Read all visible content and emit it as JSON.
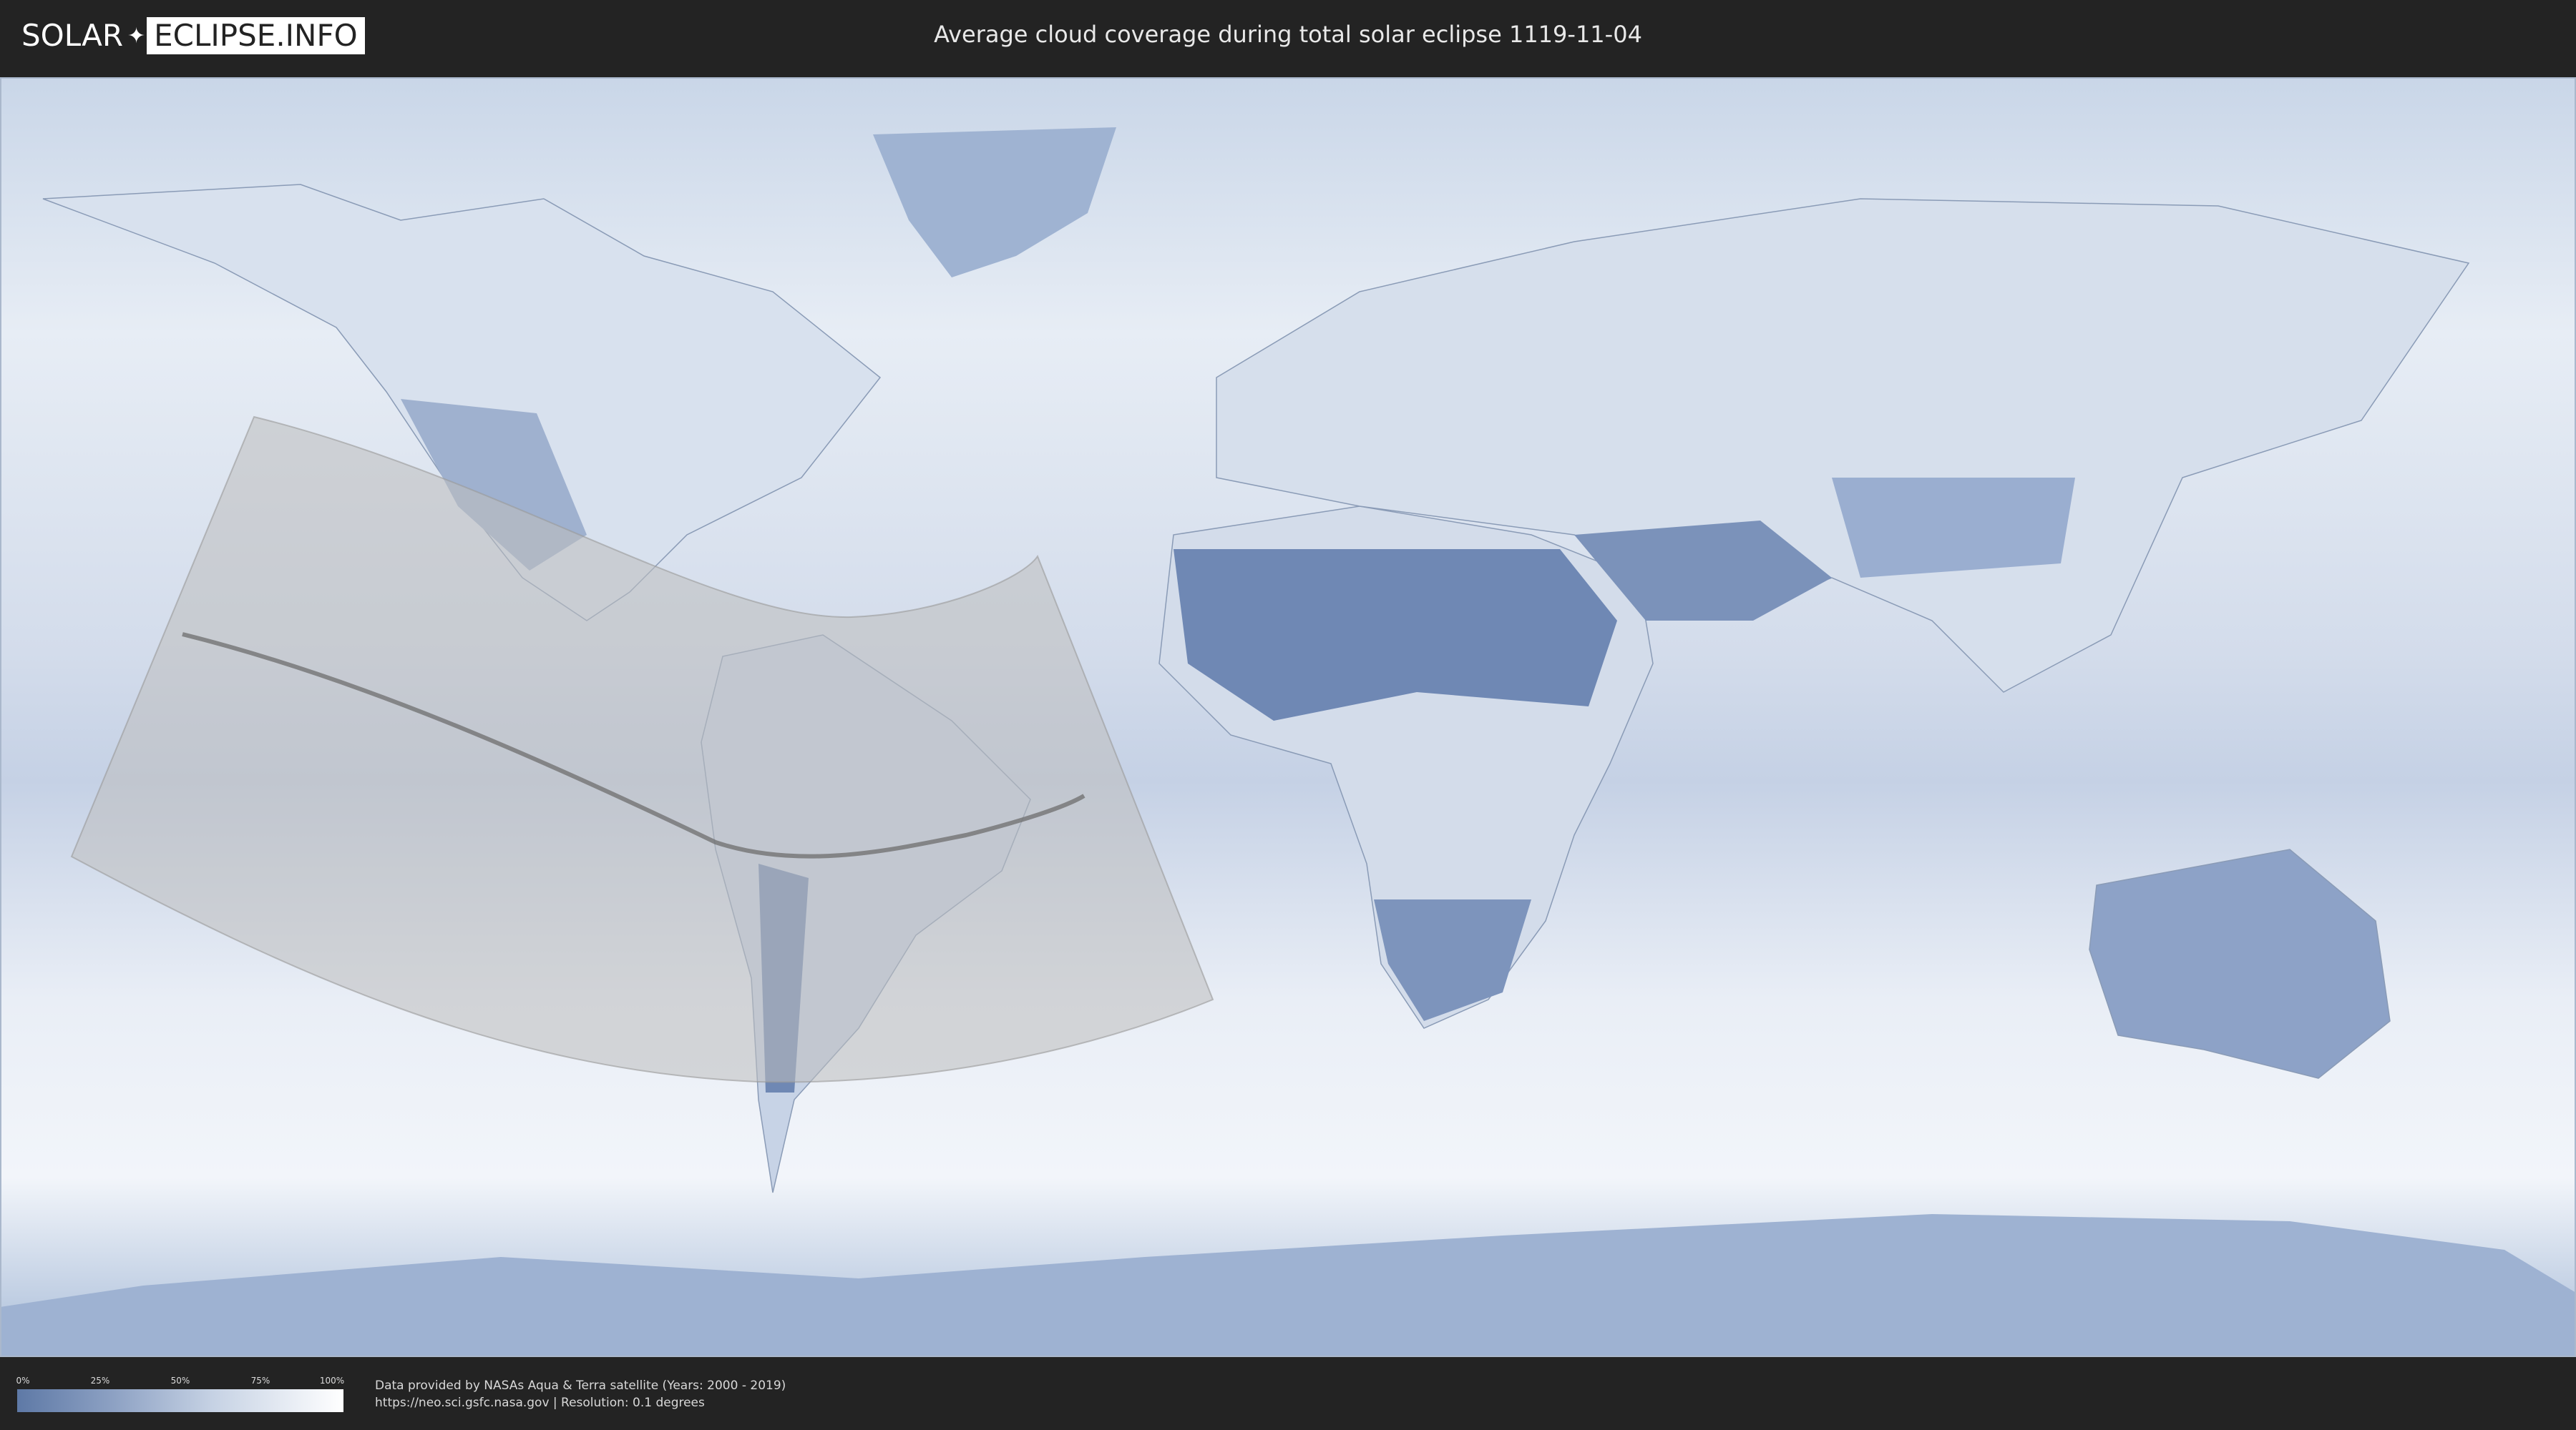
{
  "header": {
    "logo_left": "SOLAR",
    "logo_right": "ECLIPSE.INFO",
    "title": "Average cloud coverage during total solar eclipse 1119-11-04"
  },
  "map": {
    "description_colors": {
      "ocean_clouds": "#dfe7f2",
      "clear_sky": "#6f88b4",
      "eclipse_region": "#c8c8c8",
      "central_path": "#707070"
    }
  },
  "legend": {
    "ticks": [
      "0%",
      "25%",
      "50%",
      "75%",
      "100%"
    ],
    "gradient": [
      "#5e79a6",
      "#ffffff"
    ]
  },
  "footer": {
    "source_line1": "Data provided by NASAs Aqua & Terra satellite (Years: 2000 - 2019)",
    "source_line2": "https://neo.sci.gsfc.nasa.gov | Resolution: 0.1 degrees"
  }
}
